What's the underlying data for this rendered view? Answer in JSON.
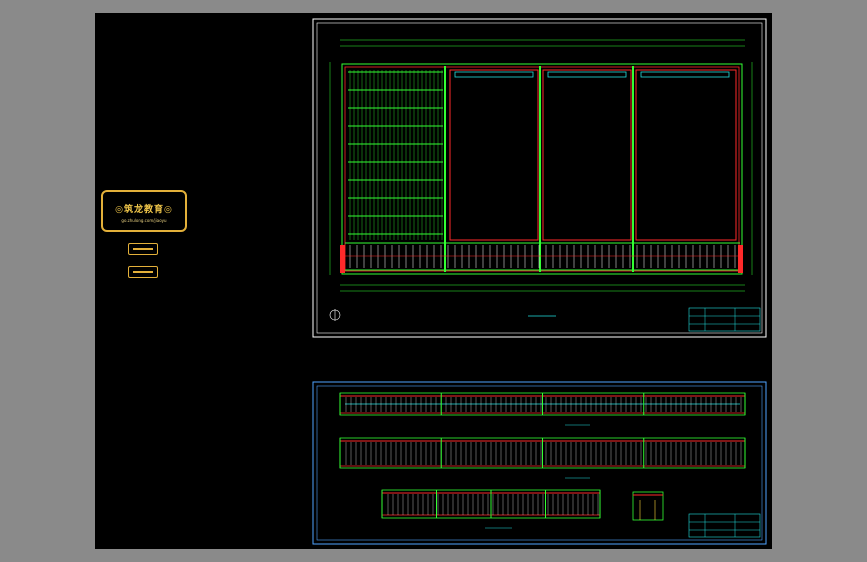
{
  "stamp": {
    "title": "◎筑龙教育◎",
    "url": "go.zhulong.com/jiaoyu"
  },
  "colors": {
    "background": "#000000",
    "frame": "#ffffff",
    "frame_blue": "#4fa3ff",
    "green": "#33ff33",
    "red": "#ff2a2a",
    "cyan": "#22e0e0",
    "yellow": "#ffd83a",
    "stamp": "#e3b03a"
  }
}
